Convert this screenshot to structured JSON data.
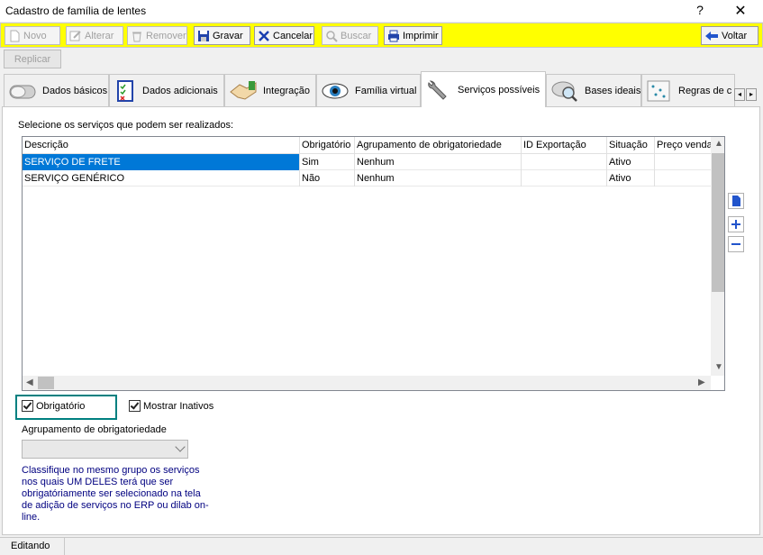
{
  "window": {
    "title": "Cadastro de família de lentes",
    "help": "?",
    "close": "✕"
  },
  "toolbar": {
    "novo": "Novo",
    "alterar": "Alterar",
    "remover": "Remover",
    "gravar": "Gravar",
    "cancelar": "Cancelar",
    "buscar": "Buscar",
    "imprimir": "Imprimir",
    "voltar": "Voltar"
  },
  "replicar": "Replicar",
  "tabs": [
    {
      "label": "Dados básicos",
      "icon": "toggle-icon"
    },
    {
      "label": "Dados adicionais",
      "icon": "checklist-icon"
    },
    {
      "label": "Integração",
      "icon": "handshake-icon"
    },
    {
      "label": "Família virtual",
      "icon": "eye-icon"
    },
    {
      "label": "Serviços possíveis",
      "icon": "wrench-icon"
    },
    {
      "label": "Bases ideais",
      "icon": "search-lens-icon"
    },
    {
      "label": "Regras de c",
      "icon": "dots-icon"
    }
  ],
  "instruction": "Selecione os serviços que podem ser realizados:",
  "grid": {
    "columns": [
      "Descrição",
      "Obrigatório",
      "Agrupamento de obrigatoriedade",
      "ID Exportação",
      "Situação",
      "Preço venda"
    ],
    "rows": [
      [
        "SERVIÇO DE FRETE",
        "Sim",
        "Nenhum",
        "",
        "Ativo",
        ""
      ],
      [
        "SERVIÇO GENÉRICO",
        "Não",
        "Nenhum",
        "",
        "Ativo",
        ""
      ]
    ],
    "selected_row": 0
  },
  "options": {
    "obrigatorio": {
      "label": "Obrigatório",
      "checked": true
    },
    "mostrar_inativos": {
      "label": "Mostrar Inativos",
      "checked": true
    }
  },
  "agrupamento": {
    "label": "Agrupamento de obrigatoriedade",
    "value": ""
  },
  "hint": "Classifique no mesmo grupo os serviços nos quais UM DELES terá que ser obrigatóriamente ser selecionado na tela de adição de serviços no ERP ou dilab on-line.",
  "status": "Editando",
  "colors": {
    "toolbar": "#ffff00",
    "selection": "#0078d7",
    "highlight": "#008080",
    "hint": "#000080"
  }
}
